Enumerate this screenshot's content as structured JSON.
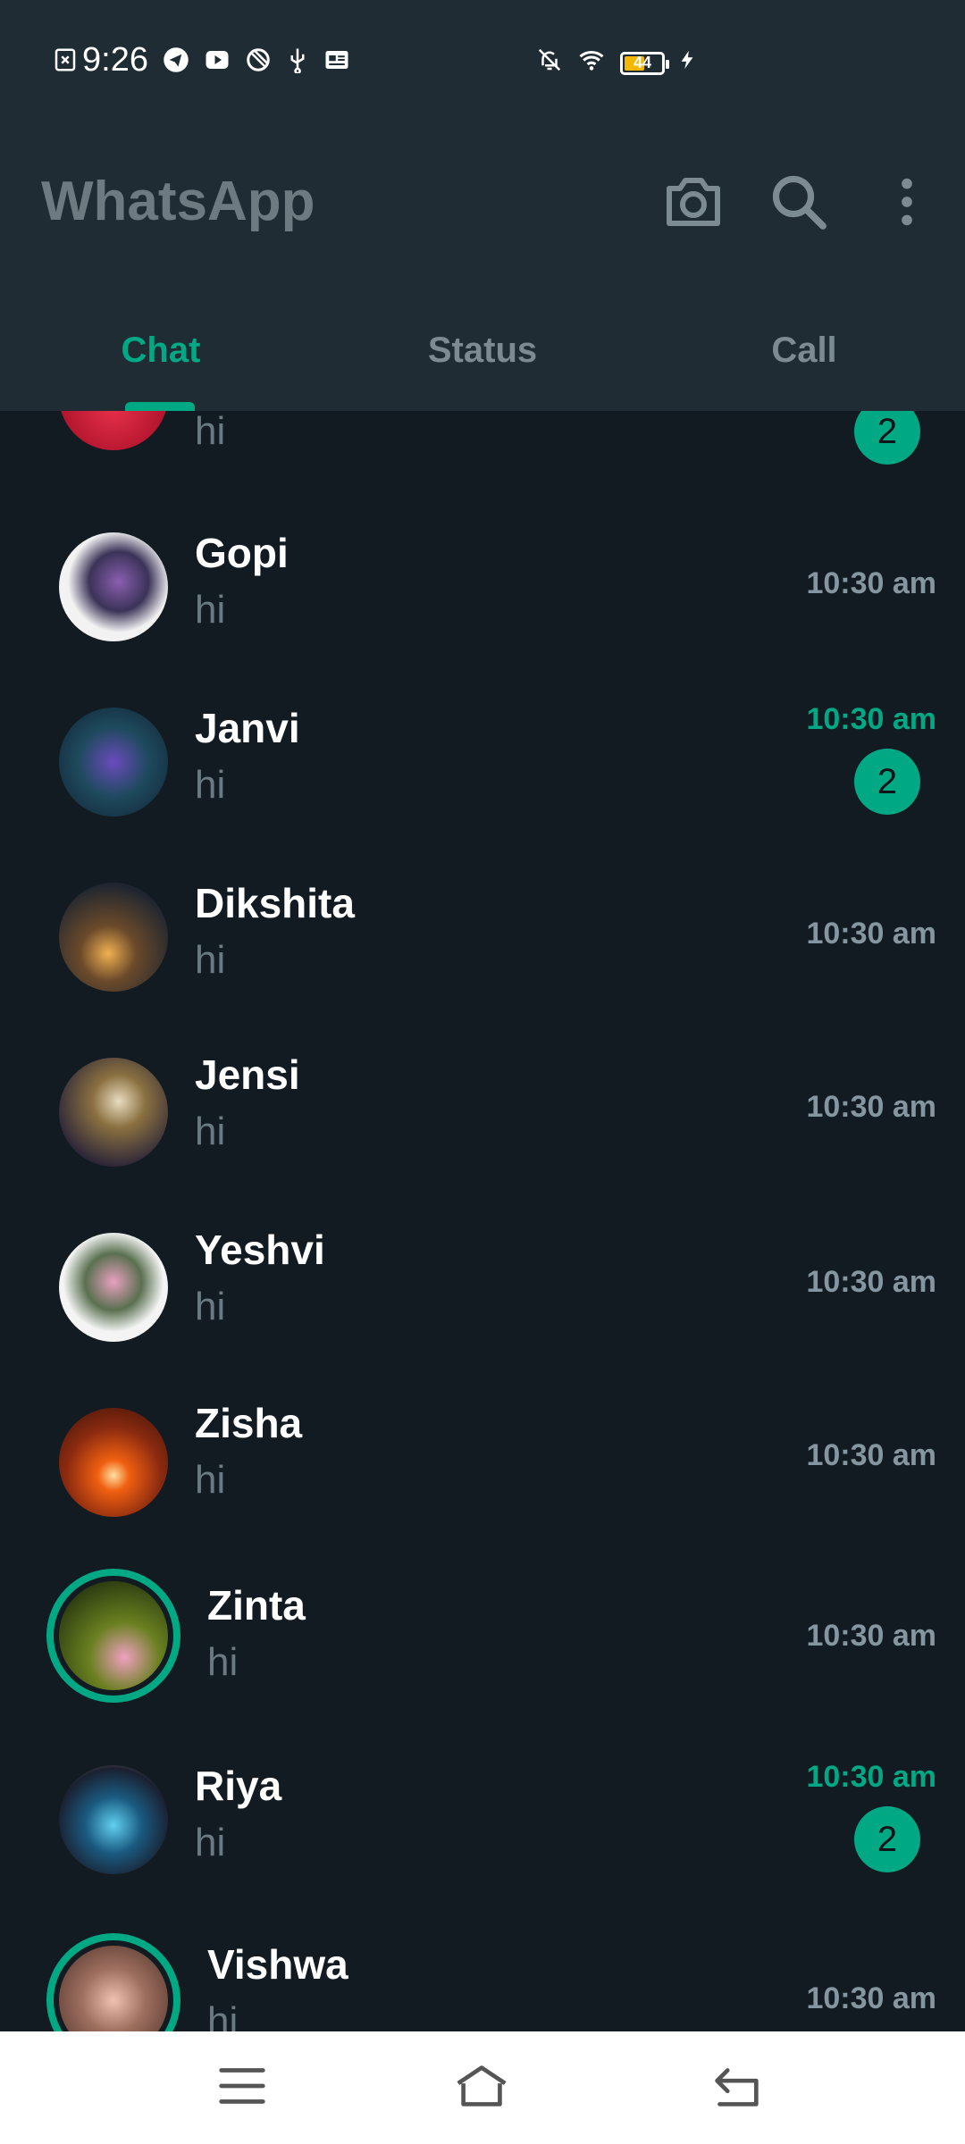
{
  "status_bar": {
    "time": "9:26",
    "battery": "44",
    "icons": [
      "sim-off-icon",
      "telegram-icon",
      "youtube-icon",
      "data-saver-icon",
      "usb-icon",
      "news-icon",
      "bell-off-icon",
      "wifi-icon",
      "battery-icon",
      "charging-icon"
    ]
  },
  "app_bar": {
    "title": "WhatsApp",
    "actions": [
      "camera-icon",
      "search-icon",
      "more-vert-icon"
    ]
  },
  "tabs": [
    {
      "label": "Chat",
      "active": true
    },
    {
      "label": "Status",
      "active": false
    },
    {
      "label": "Call",
      "active": false
    }
  ],
  "chats": [
    {
      "name": "",
      "message": "hi",
      "time": "",
      "unread": "2",
      "time_highlight": true
    },
    {
      "name": "Gopi",
      "message": "hi",
      "time": "10:30 am",
      "unread": "",
      "time_highlight": false
    },
    {
      "name": "Janvi",
      "message": "hi",
      "time": "10:30 am",
      "unread": "2",
      "time_highlight": true
    },
    {
      "name": "Dikshita",
      "message": "hi",
      "time": "10:30 am",
      "unread": "",
      "time_highlight": false
    },
    {
      "name": "Jensi",
      "message": "hi",
      "time": "10:30 am",
      "unread": "",
      "time_highlight": false
    },
    {
      "name": "Yeshvi",
      "message": "hi",
      "time": "10:30 am",
      "unread": "",
      "time_highlight": false
    },
    {
      "name": "Zisha",
      "message": "hi",
      "time": "10:30 am",
      "unread": "",
      "time_highlight": false
    },
    {
      "name": "Zinta",
      "message": "hi",
      "time": "10:30 am",
      "unread": "",
      "time_highlight": false,
      "status_ring": true
    },
    {
      "name": "Riya",
      "message": "hi",
      "time": "10:30 am",
      "unread": "2",
      "time_highlight": true
    },
    {
      "name": "Vishwa",
      "message": "hi",
      "time": "10:30 am",
      "unread": "",
      "time_highlight": false,
      "status_ring": true
    }
  ],
  "colors": {
    "accent": "#00a884",
    "header_bg": "#1f2c34",
    "list_bg": "#111b21"
  },
  "nav_bar": {
    "buttons": [
      "menu-icon",
      "home-icon",
      "back-icon"
    ]
  }
}
